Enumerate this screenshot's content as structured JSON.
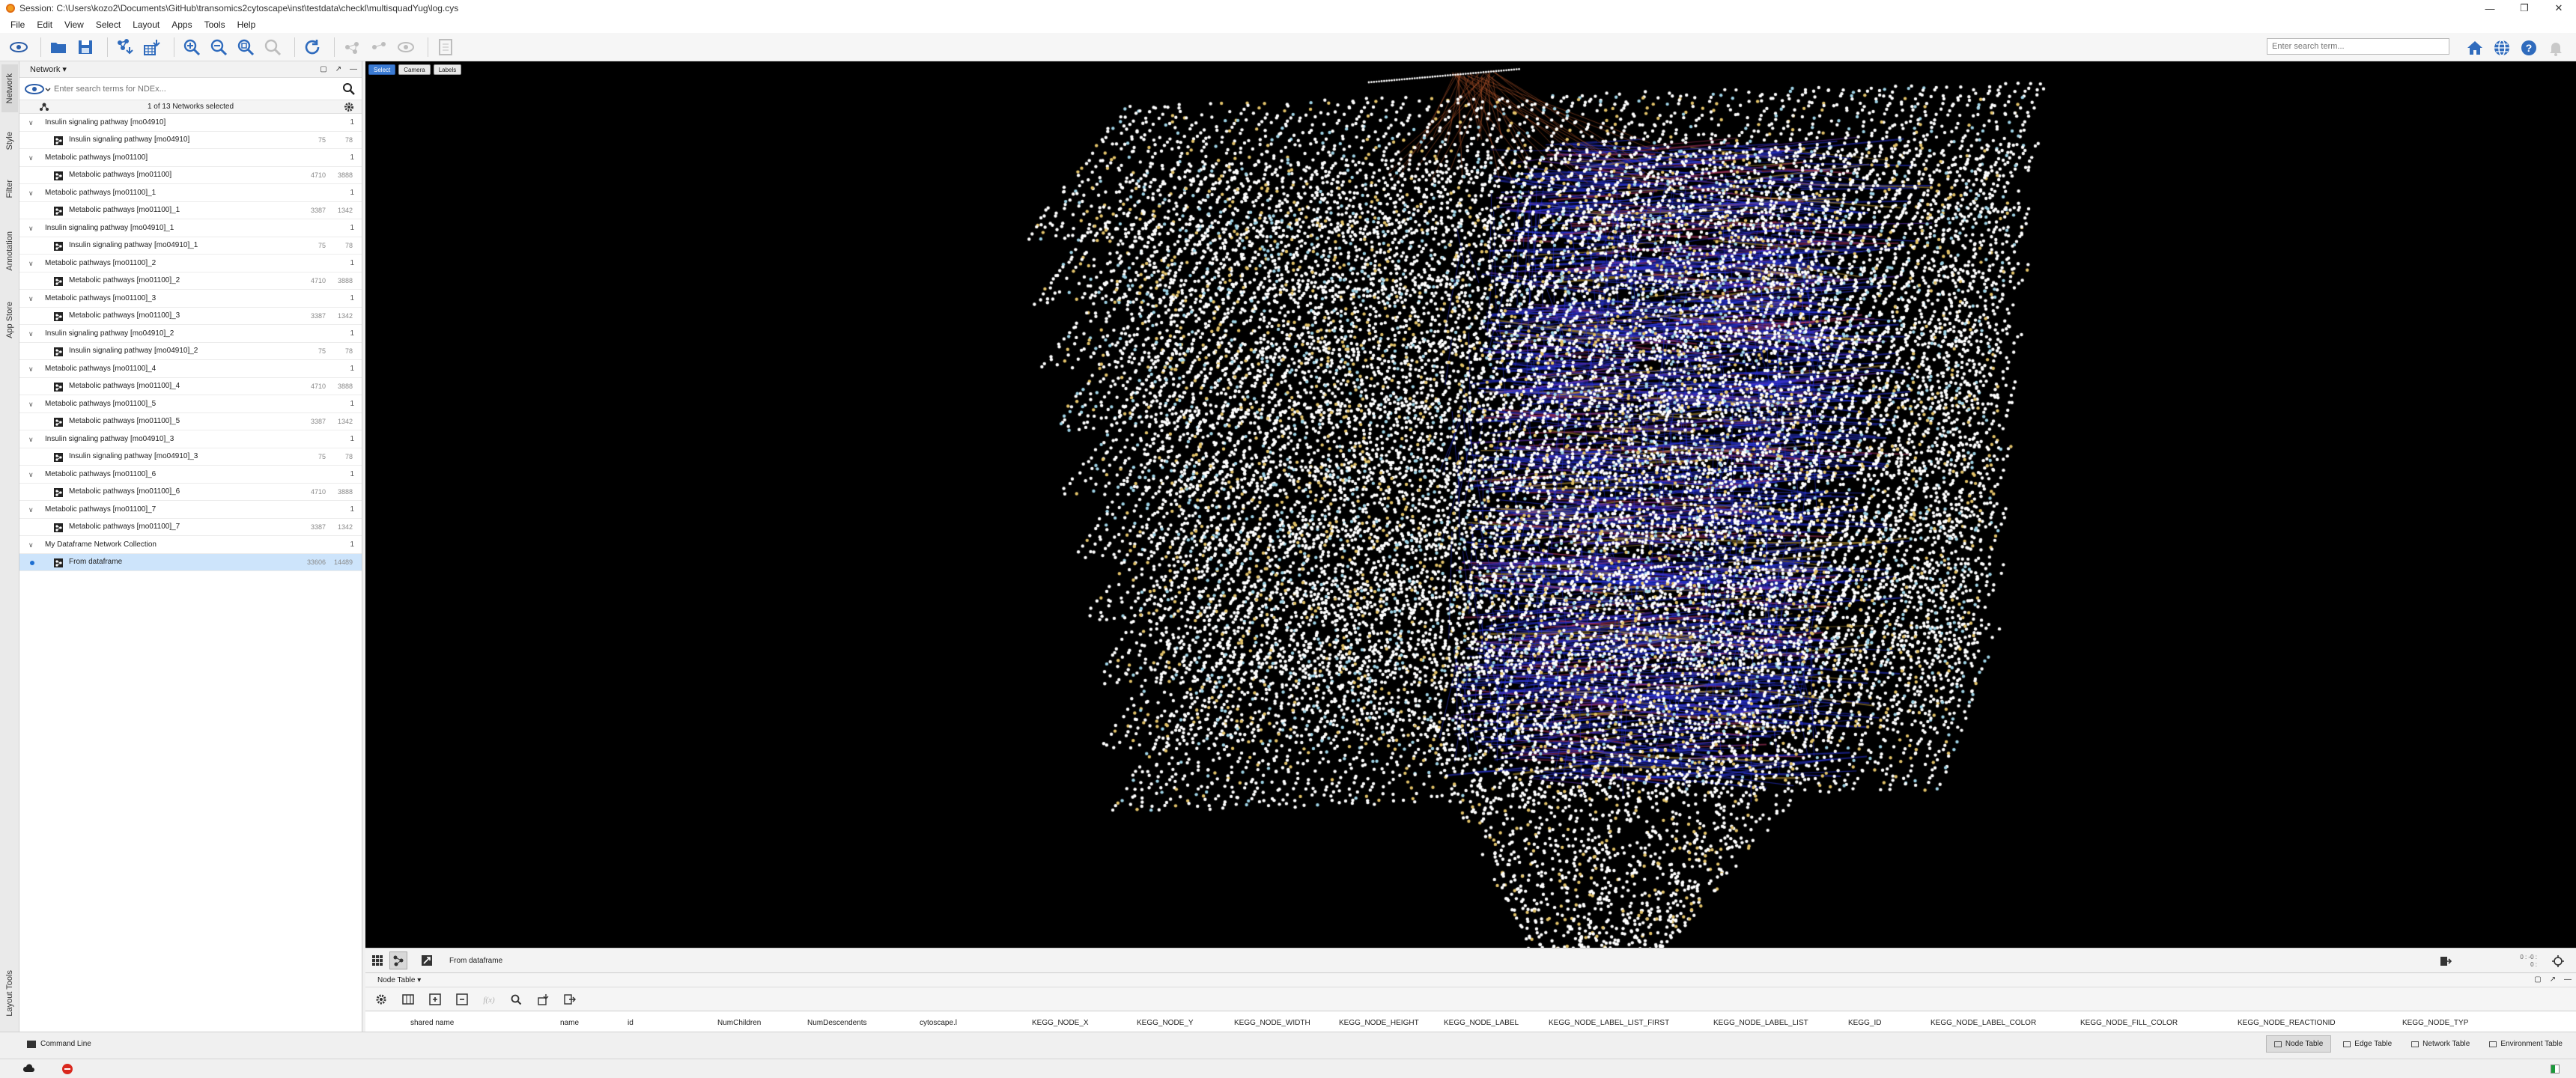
{
  "window": {
    "title": "Session: C:\\Users\\kozo2\\Documents\\GitHub\\transomics2cytoscape\\inst\\testdata\\checkl\\multisquadYug\\log.cys"
  },
  "menu": [
    "File",
    "Edit",
    "View",
    "Select",
    "Layout",
    "Apps",
    "Tools",
    "Help"
  ],
  "toolbar": {
    "search_placeholder": "Enter search term..."
  },
  "network_panel": {
    "dropdown_label": "Network",
    "search_placeholder": "Enter search terms for NDEx...",
    "selection_summary": "1 of 13 Networks selected",
    "tree": [
      {
        "type": "collection",
        "name": "Insulin signaling pathway [mo04910]",
        "count": "1"
      },
      {
        "type": "network",
        "name": "Insulin signaling pathway [mo04910]",
        "nodes": "75",
        "edges": "78"
      },
      {
        "type": "collection",
        "name": "Metabolic pathways [mo01100]",
        "count": "1"
      },
      {
        "type": "network",
        "name": "Metabolic pathways [mo01100]",
        "nodes": "4710",
        "edges": "3888"
      },
      {
        "type": "collection",
        "name": "Metabolic pathways [mo01100]_1",
        "count": "1"
      },
      {
        "type": "network",
        "name": "Metabolic pathways [mo01100]_1",
        "nodes": "3387",
        "edges": "1342"
      },
      {
        "type": "collection",
        "name": "Insulin signaling pathway [mo04910]_1",
        "count": "1"
      },
      {
        "type": "network",
        "name": "Insulin signaling pathway [mo04910]_1",
        "nodes": "75",
        "edges": "78"
      },
      {
        "type": "collection",
        "name": "Metabolic pathways [mo01100]_2",
        "count": "1"
      },
      {
        "type": "network",
        "name": "Metabolic pathways [mo01100]_2",
        "nodes": "4710",
        "edges": "3888"
      },
      {
        "type": "collection",
        "name": "Metabolic pathways [mo01100]_3",
        "count": "1"
      },
      {
        "type": "network",
        "name": "Metabolic pathways [mo01100]_3",
        "nodes": "3387",
        "edges": "1342"
      },
      {
        "type": "collection",
        "name": "Insulin signaling pathway [mo04910]_2",
        "count": "1"
      },
      {
        "type": "network",
        "name": "Insulin signaling pathway [mo04910]_2",
        "nodes": "75",
        "edges": "78"
      },
      {
        "type": "collection",
        "name": "Metabolic pathways [mo01100]_4",
        "count": "1"
      },
      {
        "type": "network",
        "name": "Metabolic pathways [mo01100]_4",
        "nodes": "4710",
        "edges": "3888"
      },
      {
        "type": "collection",
        "name": "Metabolic pathways [mo01100]_5",
        "count": "1"
      },
      {
        "type": "network",
        "name": "Metabolic pathways [mo01100]_5",
        "nodes": "3387",
        "edges": "1342"
      },
      {
        "type": "collection",
        "name": "Insulin signaling pathway [mo04910]_3",
        "count": "1"
      },
      {
        "type": "network",
        "name": "Insulin signaling pathway [mo04910]_3",
        "nodes": "75",
        "edges": "78"
      },
      {
        "type": "collection",
        "name": "Metabolic pathways [mo01100]_6",
        "count": "1"
      },
      {
        "type": "network",
        "name": "Metabolic pathways [mo01100]_6",
        "nodes": "4710",
        "edges": "3888"
      },
      {
        "type": "collection",
        "name": "Metabolic pathways [mo01100]_7",
        "count": "1"
      },
      {
        "type": "network",
        "name": "Metabolic pathways [mo01100]_7",
        "nodes": "3387",
        "edges": "1342"
      },
      {
        "type": "collection",
        "name": "My Dataframe Network Collection",
        "count": "1"
      },
      {
        "type": "network",
        "name": "From dataframe",
        "nodes": "33606",
        "edges": "14489",
        "selected": true
      }
    ]
  },
  "side_tabs": [
    "Network",
    "Style",
    "Filter",
    "Annotation",
    "App Store",
    "Layout Tools"
  ],
  "network_view": {
    "mode_buttons": [
      "Select",
      "Camera",
      "Labels"
    ],
    "active_mode": "Select",
    "current_network": "From dataframe",
    "coords_line1": "0 : -0 :",
    "coords_line2": "0 :",
    "node_color": "#ffffff",
    "edge_colors": [
      "#2a35d8",
      "#6a34c9",
      "#c9a23a",
      "#b83a6a"
    ]
  },
  "table_panel": {
    "dropdown_label": "Node Table",
    "columns": [
      "shared name",
      "name",
      "id",
      "NumChildren",
      "NumDescendents",
      "cytoscape.l",
      "KEGG_NODE_X",
      "KEGG_NODE_Y",
      "KEGG_NODE_WIDTH",
      "KEGG_NODE_HEIGHT",
      "KEGG_NODE_LABEL",
      "KEGG_NODE_LABEL_LIST_FIRST",
      "KEGG_NODE_LABEL_LIST",
      "KEGG_ID",
      "KEGG_NODE_LABEL_COLOR",
      "KEGG_NODE_FILL_COLOR",
      "KEGG_NODE_REACTIONID",
      "KEGG_NODE_TYP"
    ]
  },
  "status_bar": {
    "command_line": "Command Line",
    "tabs": [
      "Node Table",
      "Edge Table",
      "Network Table",
      "Environment Table"
    ],
    "active_tab": "Node Table"
  }
}
